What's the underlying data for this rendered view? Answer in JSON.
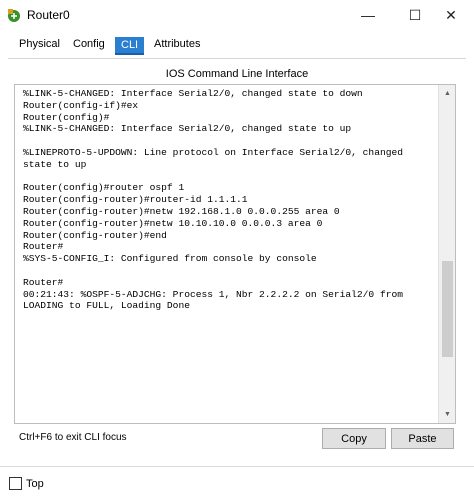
{
  "window": {
    "title": "Router0",
    "minimize_glyph": "—",
    "maximize_glyph": "☐",
    "close_glyph": "✕"
  },
  "tabs": [
    {
      "label": "Physical",
      "active": false
    },
    {
      "label": "Config",
      "active": false
    },
    {
      "label": "CLI",
      "active": true
    },
    {
      "label": "Attributes",
      "active": false
    }
  ],
  "panel": {
    "title": "IOS Command Line Interface"
  },
  "console": {
    "lines": [
      "%LINK-5-CHANGED: Interface Serial2/0, changed state to down",
      "Router(config-if)#ex",
      "Router(config)#",
      "%LINK-5-CHANGED: Interface Serial2/0, changed state to up",
      "",
      "%LINEPROTO-5-UPDOWN: Line protocol on Interface Serial2/0, changed",
      "state to up",
      "",
      "Router(config)#router ospf 1",
      "Router(config-router)#router-id 1.1.1.1",
      "Router(config-router)#netw 192.168.1.0 0.0.0.255 area 0",
      "Router(config-router)#netw 10.10.10.0 0.0.0.3 area 0",
      "Router(config-router)#end",
      "Router#",
      "%SYS-5-CONFIG_I: Configured from console by console",
      "",
      "Router#",
      "00:21:43: %OSPF-5-ADJCHG: Process 1, Nbr 2.2.2.2 on Serial2/0 from",
      "LOADING to FULL, Loading Done"
    ],
    "scroll_up_glyph": "▲",
    "scroll_down_glyph": "▼"
  },
  "footer": {
    "hint": "Ctrl+F6 to exit CLI focus",
    "copy_label": "Copy",
    "paste_label": "Paste",
    "top_label": "Top",
    "top_checked": false
  },
  "colors": {
    "active_tab": "#2a7fd0",
    "router_icon": "#3a8f2a"
  }
}
